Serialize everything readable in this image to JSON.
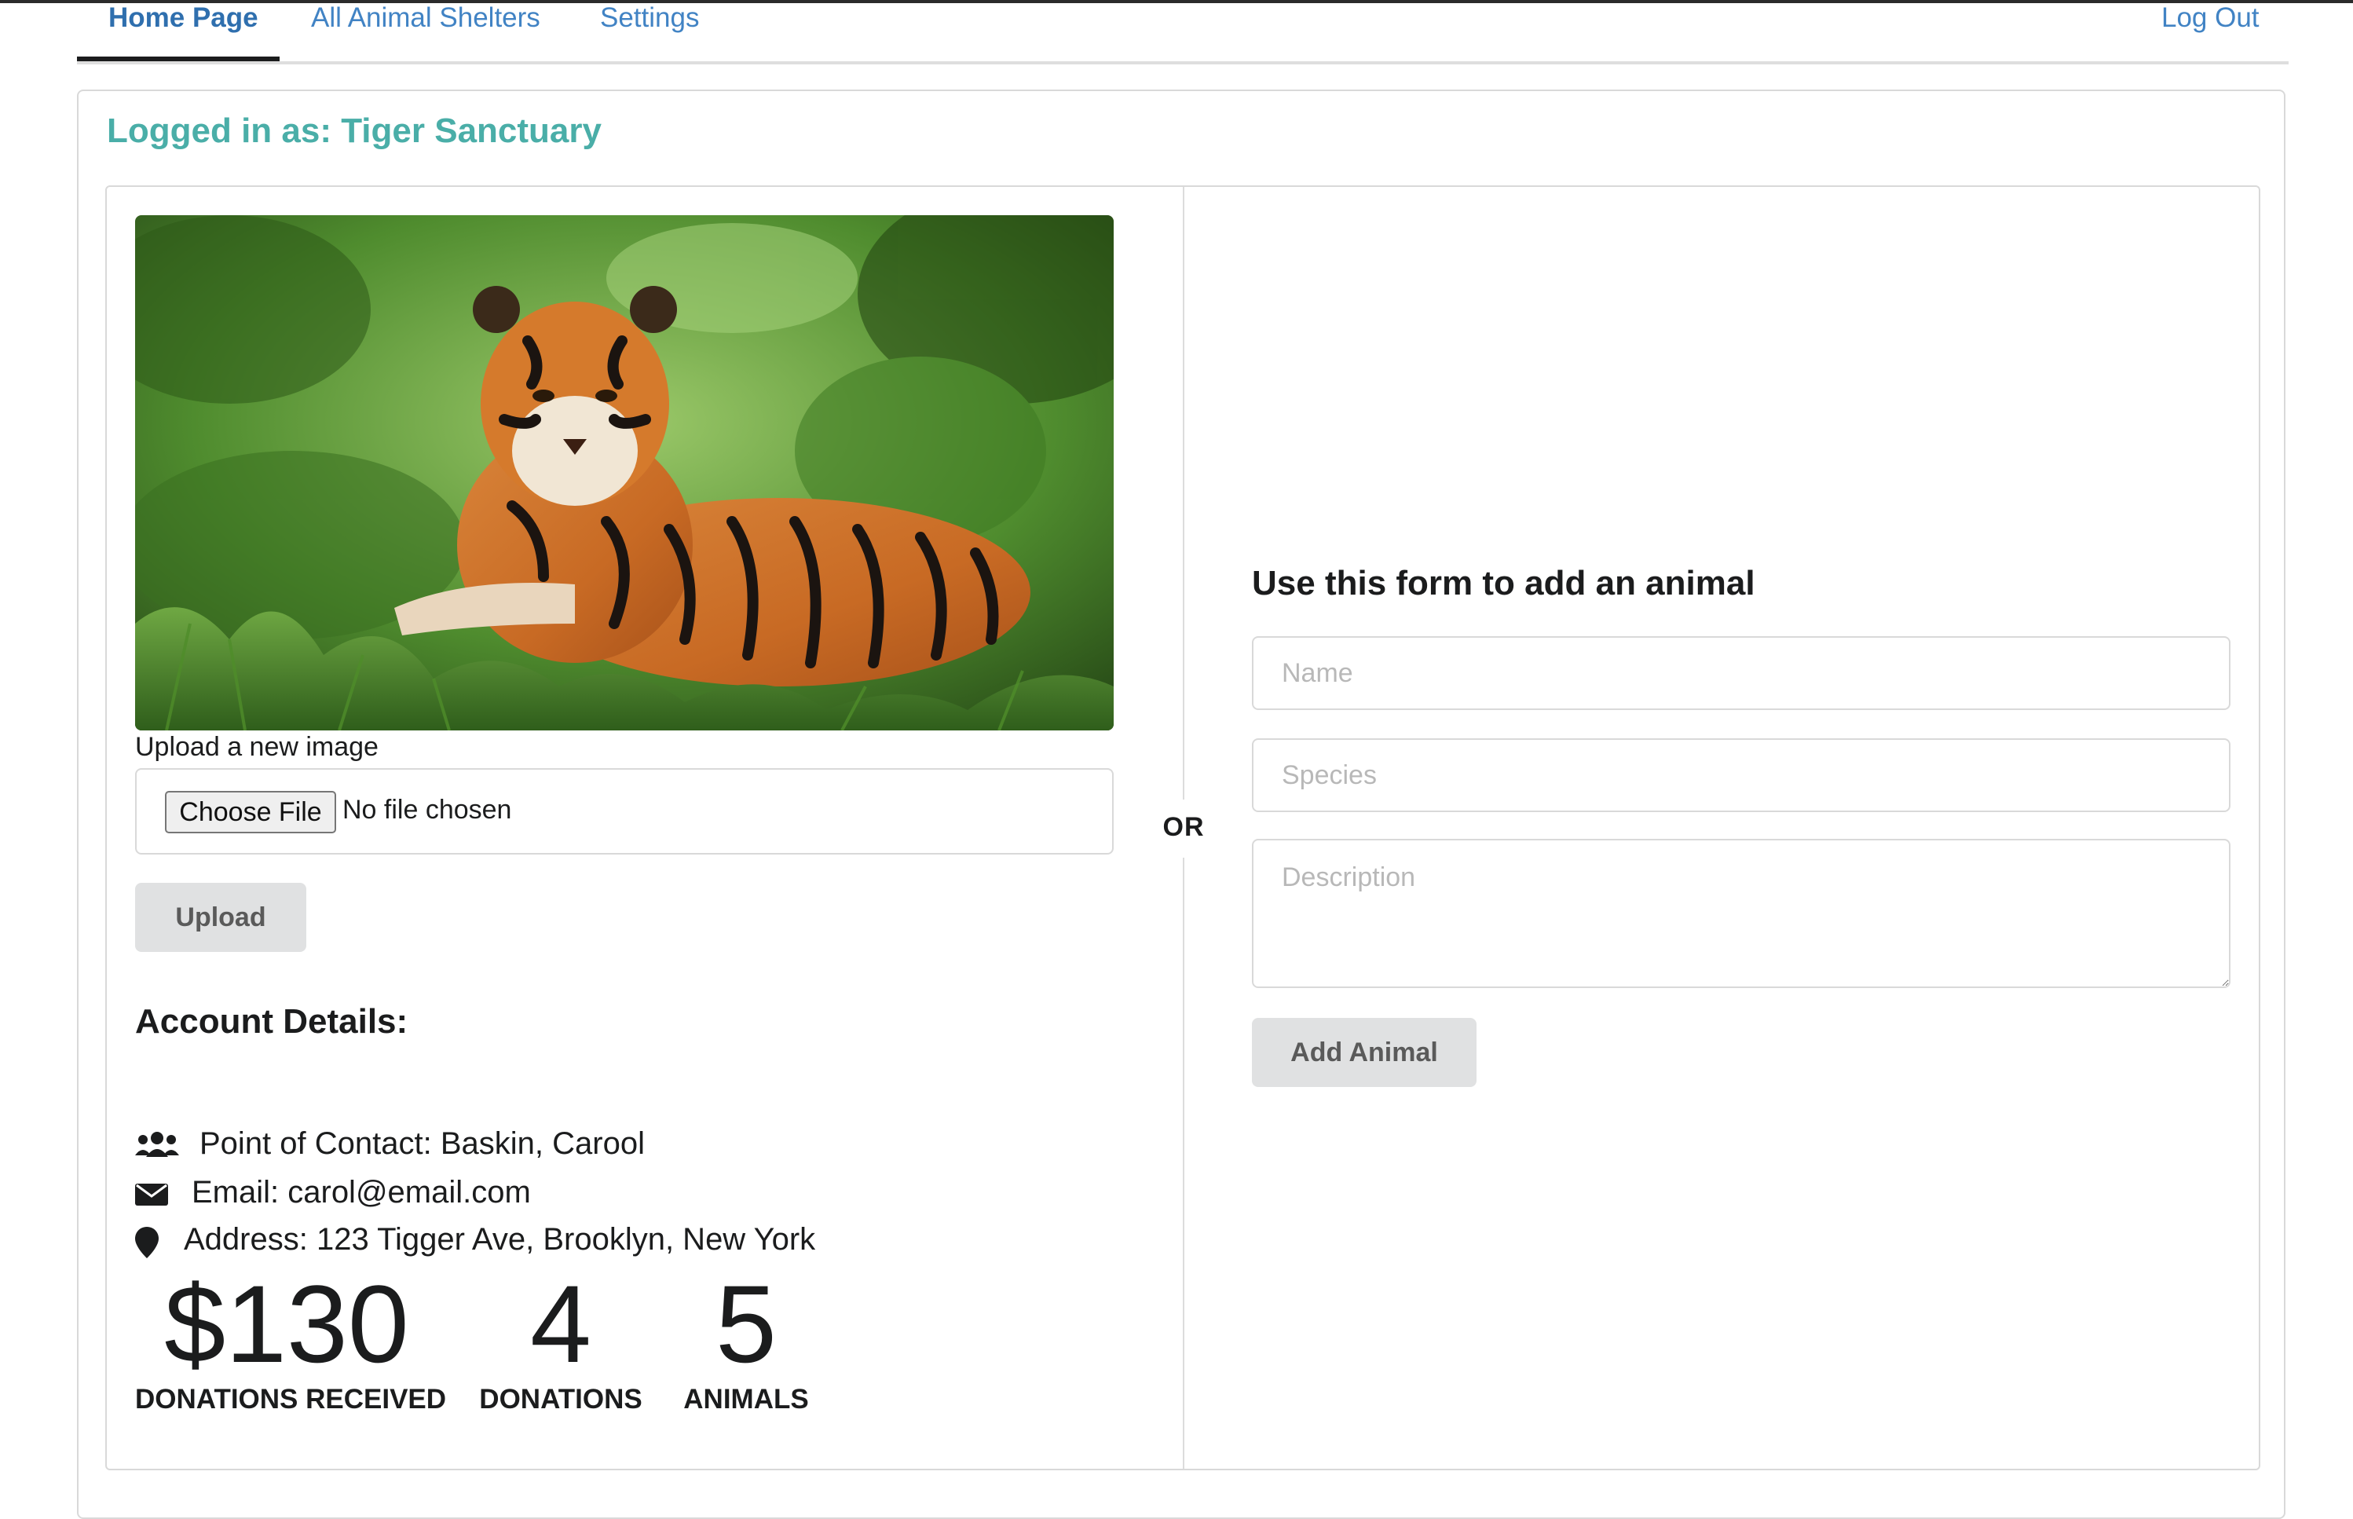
{
  "nav": {
    "items": [
      {
        "label": "Home Page",
        "active": true
      },
      {
        "label": "All Animal Shelters",
        "active": false
      },
      {
        "label": "Settings",
        "active": false
      }
    ],
    "logout_label": "Log Out"
  },
  "header": {
    "logged_in_text": "Logged in as: Tiger Sanctuary"
  },
  "profile": {
    "image_alt": "tiger-lying-in-grass",
    "upload_label": "Upload a new image",
    "choose_file_label": "Choose File",
    "no_file_text": "No file chosen",
    "upload_button": "Upload"
  },
  "divider_text": "OR",
  "account": {
    "title": "Account Details:",
    "contact": {
      "icon": "users-icon",
      "text": "Point of Contact: Baskin, Carool"
    },
    "email": {
      "icon": "envelope-icon",
      "text": "Email: carol@email.com"
    },
    "address": {
      "icon": "map-marker-icon",
      "text": "Address: 123 Tigger Ave, Brooklyn, New York"
    }
  },
  "stats": [
    {
      "value": "$130",
      "label": "DONATIONS RECEIVED"
    },
    {
      "value": "4",
      "label": "DONATIONS"
    },
    {
      "value": "5",
      "label": "ANIMALS"
    }
  ],
  "form": {
    "title": "Use this form to add an animal",
    "name_placeholder": "Name",
    "species_placeholder": "Species",
    "description_placeholder": "Description",
    "submit_label": "Add Animal"
  },
  "colors": {
    "link": "#4183c4",
    "teal_header": "#4aaea8",
    "button_bg": "#e0e1e2"
  }
}
